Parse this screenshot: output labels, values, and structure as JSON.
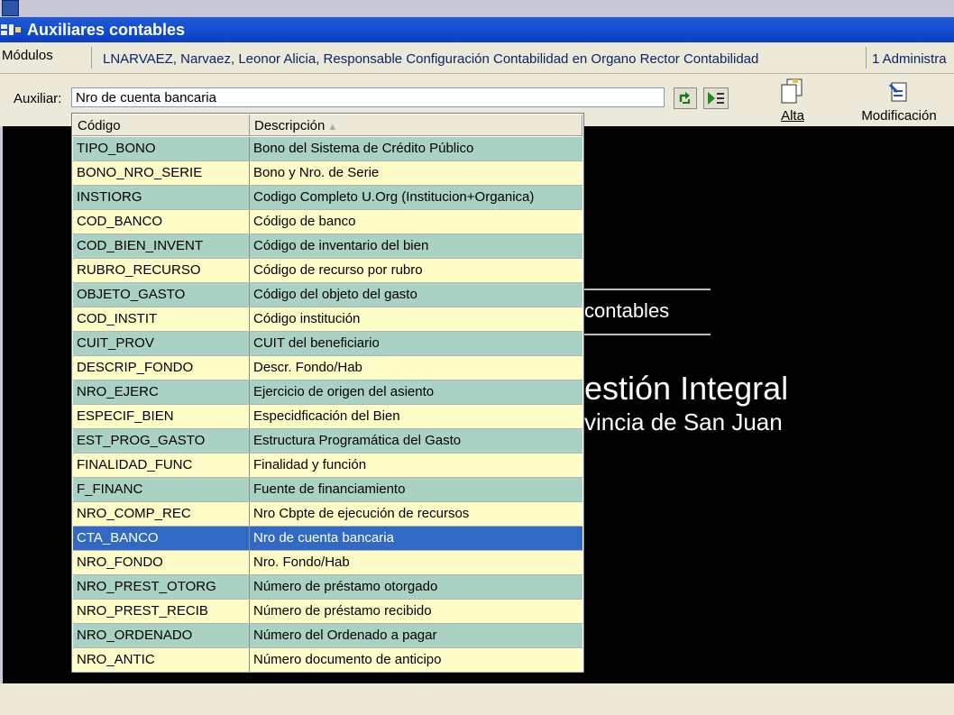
{
  "window": {
    "title": "Auxiliares contables"
  },
  "infobar": {
    "modulos": "Módulos",
    "user": "LNARVAEZ, Narvaez, Leonor Alicia, Responsable Configuración Contabilidad en Organo Rector Contabilidad",
    "admin": "1 Administra"
  },
  "toolbar": {
    "auxiliar_label": "Auxiliar:",
    "auxiliar_value": "Nro de cuenta bancaria",
    "alta": "Alta",
    "modificacion": "Modificación"
  },
  "background": {
    "line1": "contables",
    "line2": "estión Integral",
    "line3": "vincia de San Juan"
  },
  "grid": {
    "col_codigo": "Código",
    "col_descripcion": "Descripción",
    "selected_index": 16,
    "rows": [
      {
        "codigo": "TIPO_BONO",
        "descripcion": "Bono del Sistema de Crédito Público"
      },
      {
        "codigo": "BONO_NRO_SERIE",
        "descripcion": "Bono y Nro. de Serie"
      },
      {
        "codigo": "INSTIORG",
        "descripcion": "Codigo Completo U.Org (Institucion+Organica)"
      },
      {
        "codigo": "COD_BANCO",
        "descripcion": "Código de banco"
      },
      {
        "codigo": "COD_BIEN_INVENT",
        "descripcion": "Código de inventario del bien"
      },
      {
        "codigo": "RUBRO_RECURSO",
        "descripcion": "Código de recurso por rubro"
      },
      {
        "codigo": "OBJETO_GASTO",
        "descripcion": "Código del objeto del gasto"
      },
      {
        "codigo": "COD_INSTIT",
        "descripcion": "Código institución"
      },
      {
        "codigo": "CUIT_PROV",
        "descripcion": "CUIT del beneficiario"
      },
      {
        "codigo": "DESCRIP_FONDO",
        "descripcion": "Descr. Fondo/Hab"
      },
      {
        "codigo": "NRO_EJERC",
        "descripcion": "Ejercicio de origen del asiento"
      },
      {
        "codigo": "ESPECIF_BIEN",
        "descripcion": "Especidficación del Bien"
      },
      {
        "codigo": "EST_PROG_GASTO",
        "descripcion": "Estructura Programática del Gasto"
      },
      {
        "codigo": "FINALIDAD_FUNC",
        "descripcion": "Finalidad y función"
      },
      {
        "codigo": "F_FINANC",
        "descripcion": "Fuente de financiamiento"
      },
      {
        "codigo": "NRO_COMP_REC",
        "descripcion": "Nro Cbpte  de ejecución de recursos"
      },
      {
        "codigo": "CTA_BANCO",
        "descripcion": "Nro de cuenta bancaria"
      },
      {
        "codigo": "NRO_FONDO",
        "descripcion": "Nro. Fondo/Hab"
      },
      {
        "codigo": "NRO_PREST_OTORG",
        "descripcion": "Número de préstamo otorgado"
      },
      {
        "codigo": "NRO_PREST_RECIB",
        "descripcion": "Número de préstamo recibido"
      },
      {
        "codigo": "NRO_ORDENADO",
        "descripcion": "Número del Ordenado a pagar"
      },
      {
        "codigo": "NRO_ANTIC",
        "descripcion": "Número documento de anticipo"
      }
    ]
  }
}
